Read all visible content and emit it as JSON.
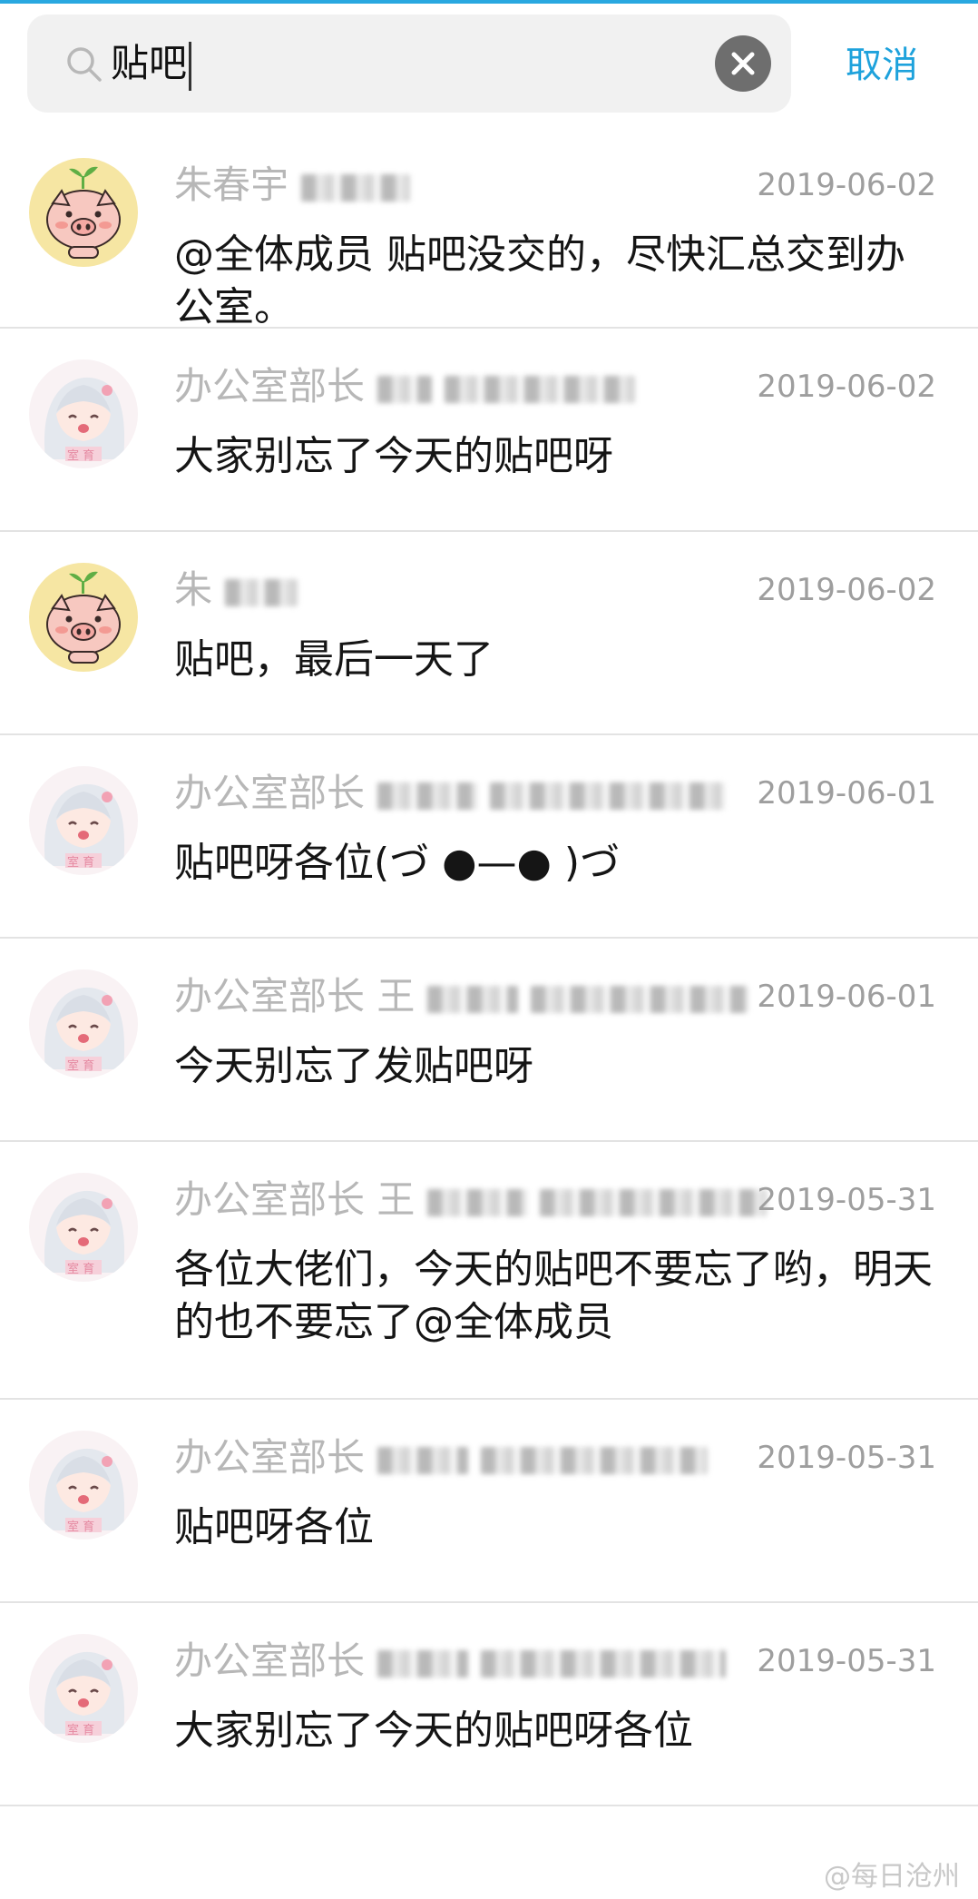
{
  "search": {
    "query": "贴吧",
    "cancel_label": "取消"
  },
  "results": [
    {
      "avatar": "pig-avatar",
      "sender": "朱春宇",
      "date": "2019-06-02",
      "message": "@全体成员 贴吧没交的，尽快汇总交到办公室。"
    },
    {
      "avatar": "anime-avatar",
      "sender": "办公室部长",
      "date": "2019-06-02",
      "message": "大家别忘了今天的贴吧呀"
    },
    {
      "avatar": "pig-avatar",
      "sender": "朱",
      "date": "2019-06-02",
      "message": "贴吧，最后一天了"
    },
    {
      "avatar": "anime-avatar",
      "sender": "办公室部长",
      "date": "2019-06-01",
      "message": "贴吧呀各位(づ ●—● )づ"
    },
    {
      "avatar": "anime-avatar",
      "sender": "办公室部长 王",
      "date": "2019-06-01",
      "message": "今天别忘了发贴吧呀"
    },
    {
      "avatar": "anime-avatar",
      "sender": "办公室部长 王",
      "date": "2019-05-31",
      "message": "各位大佬们，今天的贴吧不要忘了哟，明天的也不要忘了@全体成员"
    },
    {
      "avatar": "anime-avatar",
      "sender": "办公室部长",
      "date": "2019-05-31",
      "message": "贴吧呀各位"
    },
    {
      "avatar": "anime-avatar",
      "sender": "办公室部长",
      "date": "2019-05-31",
      "message": "大家别忘了今天的贴吧呀各位"
    }
  ],
  "watermark": "@每日沧州",
  "colors": {
    "accent": "#1ea2dc",
    "divider": "#e3e3e3",
    "meta": "#b7b7b7"
  }
}
